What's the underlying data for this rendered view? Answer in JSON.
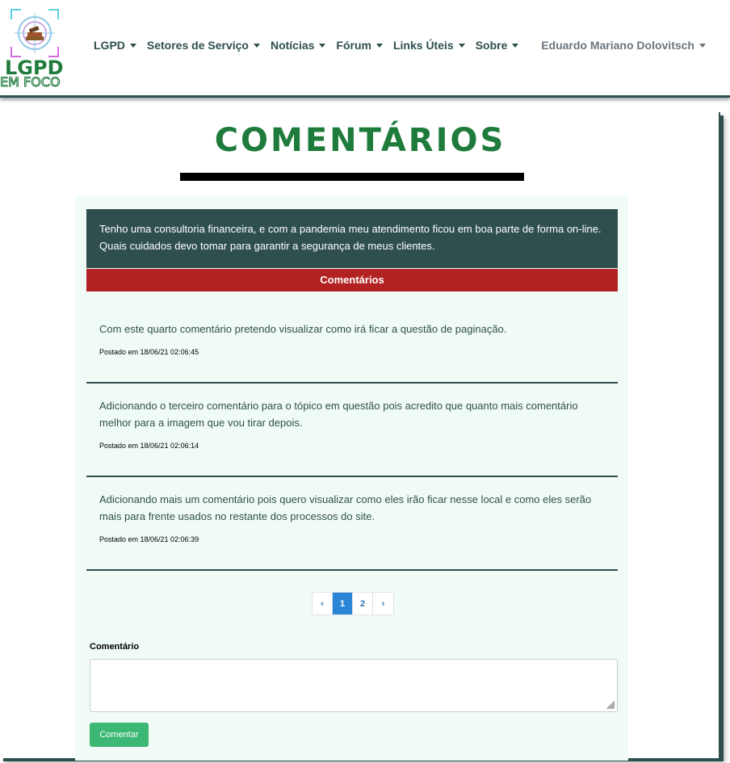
{
  "logo": {
    "line1": "LGPD",
    "line2": "EM FOCO"
  },
  "nav": {
    "items": [
      {
        "label": "LGPD"
      },
      {
        "label": "Setores de Serviço"
      },
      {
        "label": "Notícias"
      },
      {
        "label": "Fórum"
      },
      {
        "label": "Links Úteis"
      },
      {
        "label": "Sobre"
      }
    ],
    "user": "Eduardo Mariano Dolovitsch"
  },
  "page": {
    "title": "COMENTÁRIOS",
    "question": "Tenho uma consultoria financeira, e com a pandemia meu atendimento ficou em boa parte de forma on-line. Quais cuidados devo tomar para garantir a segurança de meus clientes.",
    "comments_header": "Comentários"
  },
  "comments": [
    {
      "text": "Com este quarto comentário pretendo visualizar como irá ficar a questão de paginação.",
      "date": "Postado em 18/06/21 02:06:45"
    },
    {
      "text": "Adicionando o terceiro comentário para o tópico em questão pois acredito que quanto mais comentário melhor para a imagem que vou tirar depois.",
      "date": "Postado em 18/06/21 02:06:14"
    },
    {
      "text": "Adicionando mais um comentário pois quero visualizar como eles irão ficar nesse local e como eles serão mais para frente usados no restante dos processos do site.",
      "date": "Postado em 18/06/21 02:06:39"
    }
  ],
  "pagination": {
    "prev": "‹",
    "pages": [
      "1",
      "2"
    ],
    "current": "1",
    "next": "›"
  },
  "form": {
    "label": "Comentário",
    "textarea_value": "",
    "submit": "Comentar"
  },
  "colors": {
    "primary": "#2f4f4f",
    "brand_green": "#1e7b3b",
    "header_red": "#b22222",
    "button_green": "#3cb874",
    "page_active": "#2a85d6"
  }
}
